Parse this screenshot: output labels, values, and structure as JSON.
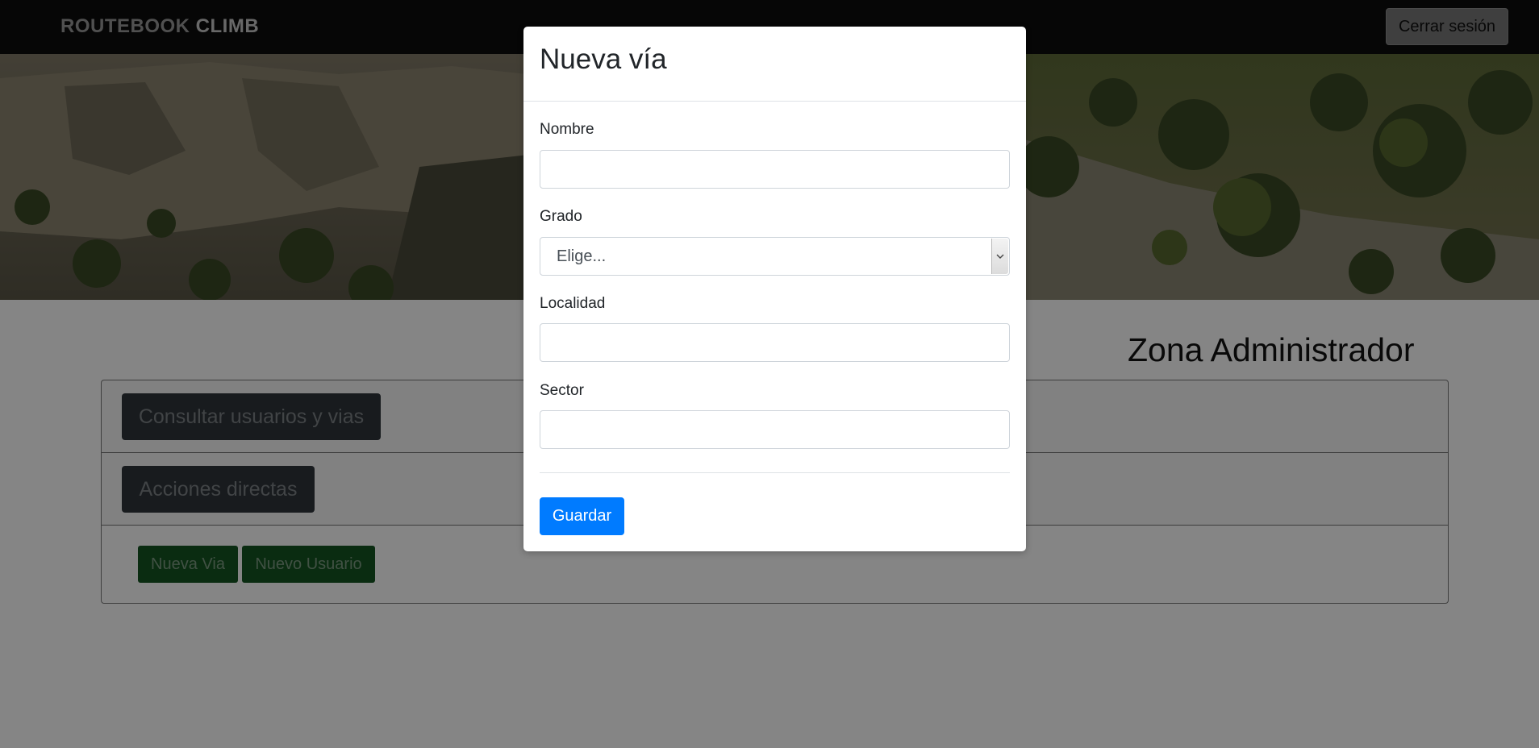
{
  "navbar": {
    "brand_part1": "ROUTEBOOK",
    "brand_part2": "CLIMB",
    "logout_label": "Cerrar sesión"
  },
  "main": {
    "zone_title": "Zona Administrador",
    "consultar_label": "Consultar usuarios y vias",
    "acciones_label": "Acciones directas",
    "nueva_via_label": "Nueva Via",
    "nuevo_usuario_label": "Nuevo Usuario"
  },
  "modal": {
    "title": "Nueva vía",
    "fields": {
      "nombre_label": "Nombre",
      "nombre_value": "",
      "grado_label": "Grado",
      "grado_selected": "Elige...",
      "localidad_label": "Localidad",
      "localidad_value": "",
      "sector_label": "Sector",
      "sector_value": ""
    },
    "save_label": "Guardar"
  },
  "colors": {
    "navbar_bg": "#0d0d0d",
    "primary": "#007bff",
    "success": "#28a745",
    "secondary": "#6c757d",
    "backdrop": "rgba(0,0,0,0.48)"
  }
}
